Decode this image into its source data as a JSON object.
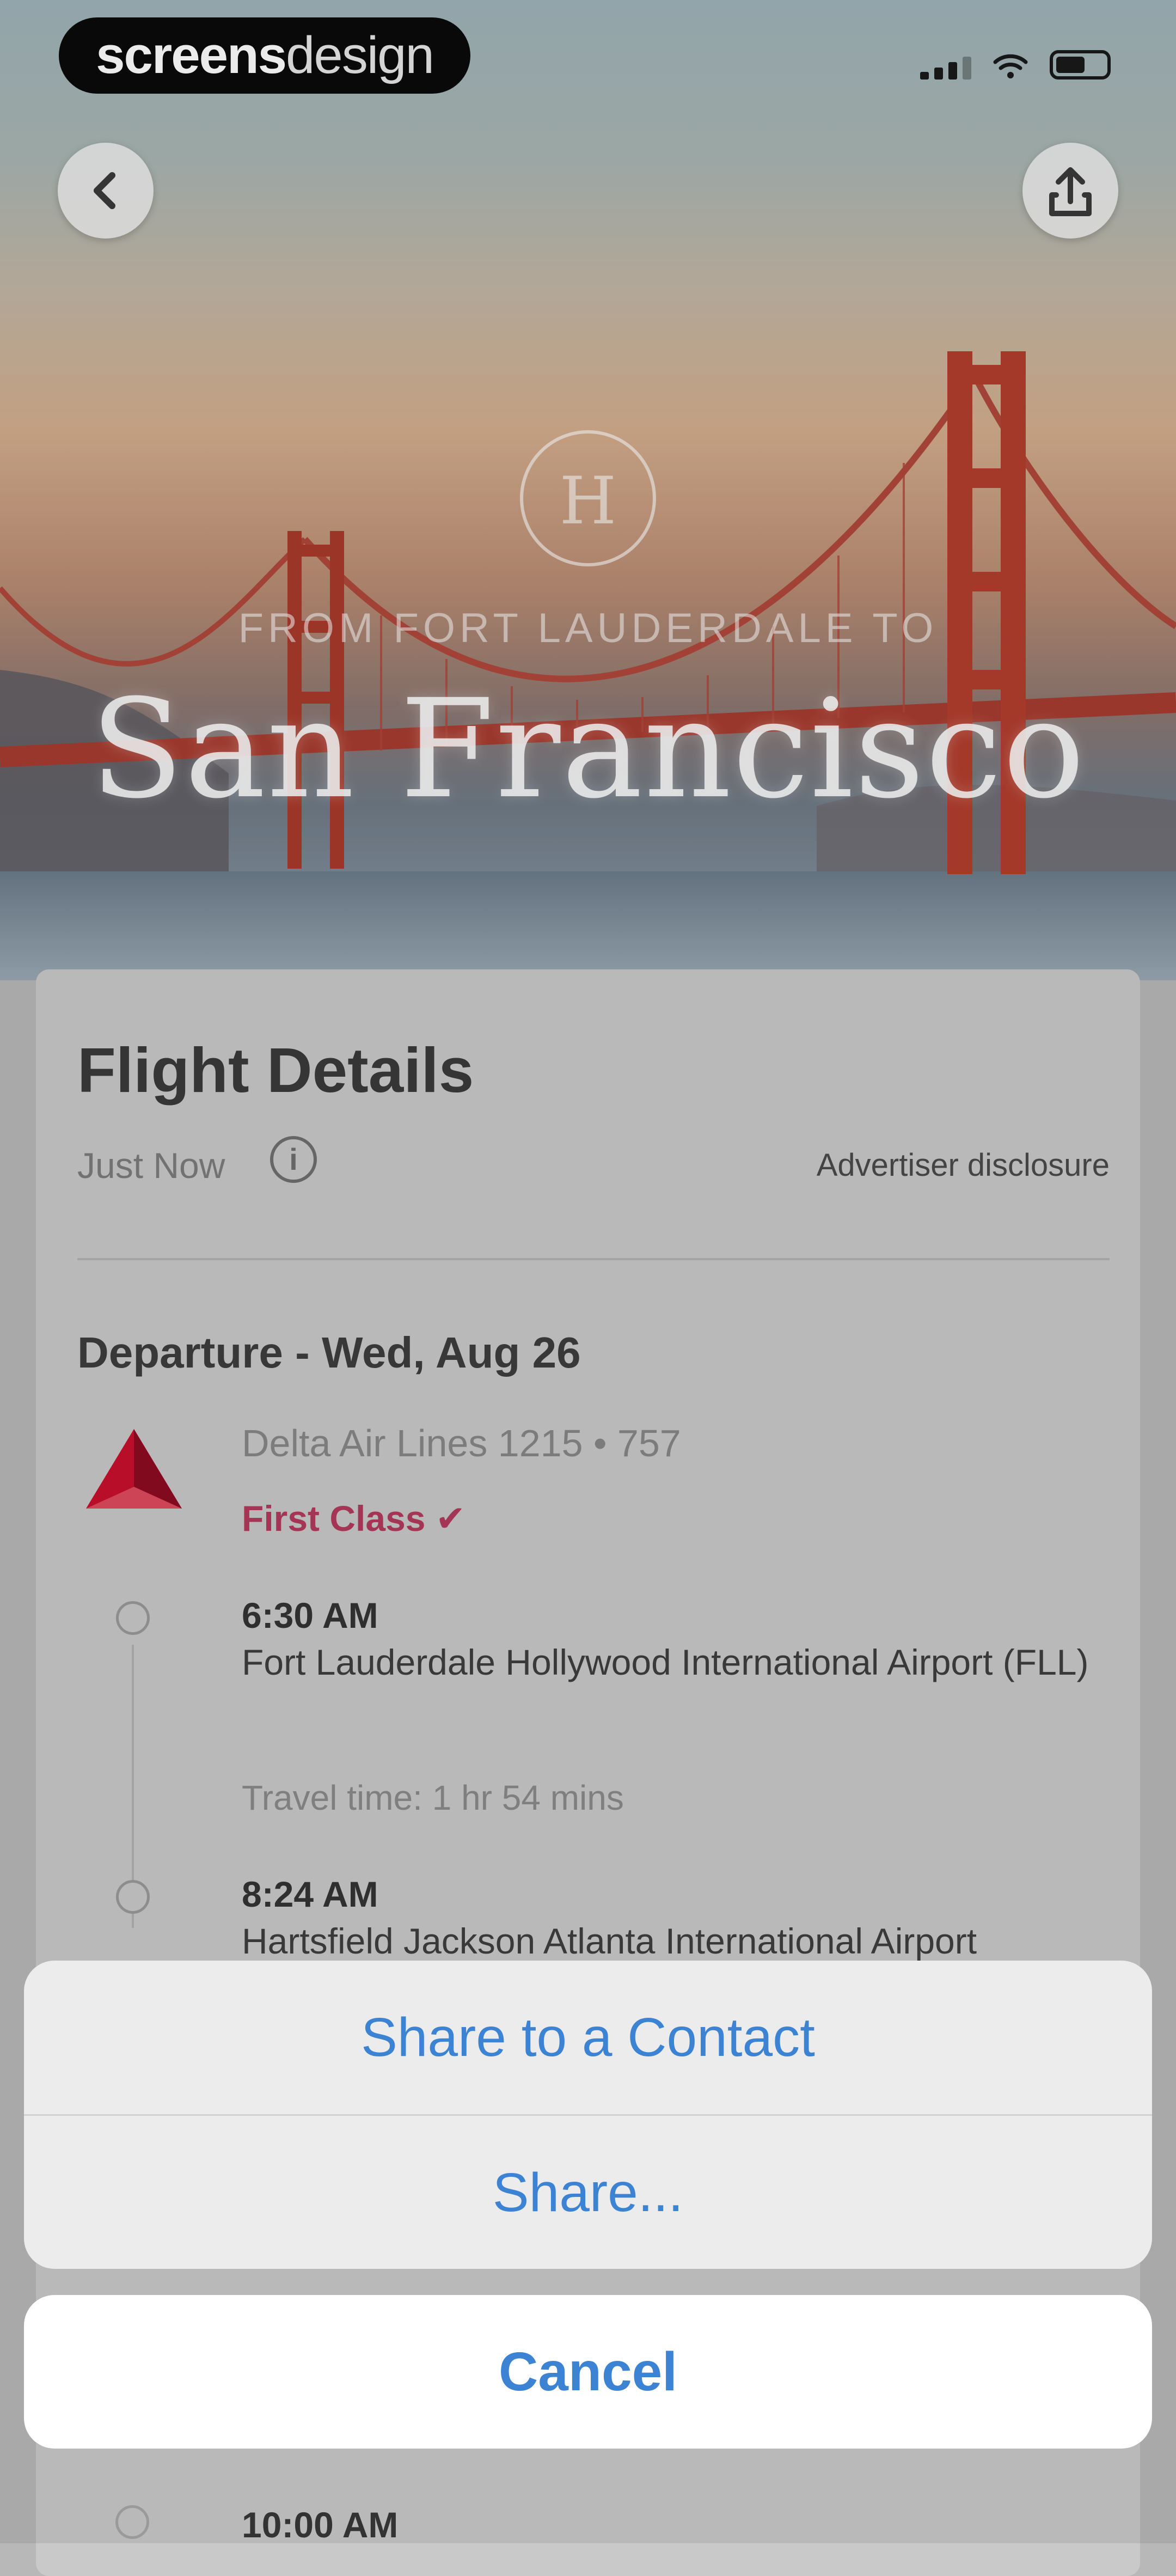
{
  "status_bar": {
    "brand_bold": "screens",
    "brand_light": "design"
  },
  "nav": {
    "back_icon": "chevron-left-icon",
    "share_icon": "share-icon"
  },
  "hero": {
    "subtitle": "FROM FORT LAUDERDALE TO",
    "title": "San Francisco",
    "logo_text": "H"
  },
  "card": {
    "title": "Flight Details",
    "updated": "Just Now",
    "info_icon": "i",
    "advertiser": "Advertiser disclosure",
    "departure_heading": "Departure - Wed, Aug 26",
    "airline_flight": "Delta Air Lines 1215 • 757",
    "cabin": "First Class",
    "cabin_mark": "✔",
    "stops": [
      {
        "time": "6:30 AM",
        "airport": "Fort Lauderdale Hollywood International Airport (FLL)"
      },
      {
        "time": "8:24 AM",
        "airport": "Hartsfield Jackson Atlanta International Airport"
      }
    ],
    "travel_time": "Travel time: 1 hr 54 mins",
    "next_time": "10:00 AM"
  },
  "action_sheet": {
    "option_1": "Share to a Contact",
    "option_2": "Share...",
    "cancel": "Cancel"
  },
  "colors": {
    "accent_blue": "#3d83d4",
    "cabin_pink": "#b23a5d",
    "delta_red": "#c8102e"
  }
}
